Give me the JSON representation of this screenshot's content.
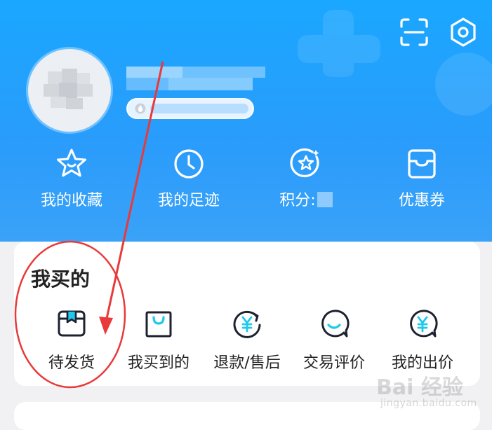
{
  "header": {
    "quick_links": [
      {
        "label": "我的收藏",
        "icon": "star-icon"
      },
      {
        "label": "我的足迹",
        "icon": "clock-icon"
      },
      {
        "label": "积分:",
        "icon": "points-icon"
      },
      {
        "label": "优惠券",
        "icon": "coupon-icon"
      }
    ],
    "actions": [
      {
        "icon": "scan-icon"
      },
      {
        "icon": "settings-gear-icon"
      }
    ]
  },
  "my_purchases": {
    "title": "我买的",
    "items": [
      {
        "label": "待发货",
        "icon": "package-icon"
      },
      {
        "label": "我买到的",
        "icon": "shopping-bag-icon"
      },
      {
        "label": "退款/售后",
        "icon": "refund-yen-icon"
      },
      {
        "label": "交易评价",
        "icon": "review-chat-icon"
      },
      {
        "label": "我的出价",
        "icon": "bid-yen-icon"
      }
    ]
  },
  "watermark": {
    "brand": "Bai 经验",
    "site": "jingyan.baidu.com"
  },
  "colors": {
    "header_bg": "#1aa7ff",
    "icon_dark": "#1c2230",
    "accent_cyan": "#1ec9ec",
    "annotation_red": "#e83a3a"
  }
}
